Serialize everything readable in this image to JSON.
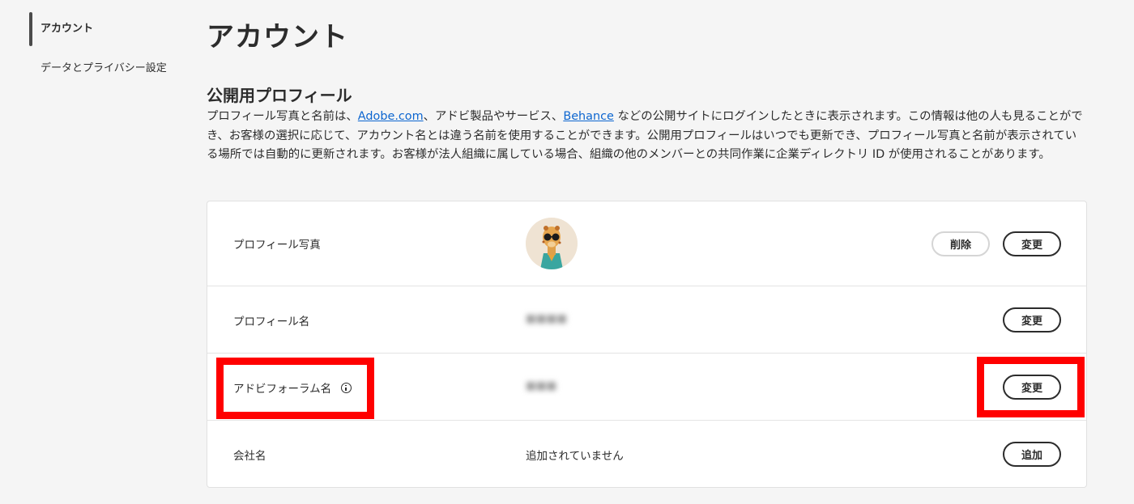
{
  "sidebar": {
    "items": [
      {
        "label": "アカウント",
        "active": true
      },
      {
        "label": "データとプライバシー設定",
        "active": false
      }
    ]
  },
  "page": {
    "title": "アカウント"
  },
  "profile_section": {
    "title": "公開用プロフィール",
    "desc_part1": "プロフィール写真と名前は、",
    "link_adobe": "Adobe.com",
    "desc_part2": "、アドビ製品やサービス、",
    "link_behance": "Behance",
    "desc_part3": " などの公開サイトにログインしたときに表示されます。この情報は他の人も見ることができ、お客様の選択に応じて、アカウント名とは違う名前を使用することができます。公開用プロフィールはいつでも更新でき、プロフィール写真と名前が表示されている場所では自動的に更新されます。お客様が法人組織に属している場合、組織の他のメンバーとの共同作業に企業ディレクトリ ID が使用されることがあります。"
  },
  "rows": {
    "photo": {
      "label": "プロフィール写真",
      "delete_label": "削除",
      "change_label": "変更"
    },
    "profile_name": {
      "label": "プロフィール名",
      "value": "■■■■",
      "change_label": "変更"
    },
    "forum_name": {
      "label": "アドビフォーラム名",
      "value": "■■■",
      "change_label": "変更"
    },
    "company": {
      "label": "会社名",
      "value": "追加されていません",
      "add_label": "追加"
    }
  },
  "colors": {
    "highlight": "#ff0000",
    "link": "#0d66d0"
  }
}
